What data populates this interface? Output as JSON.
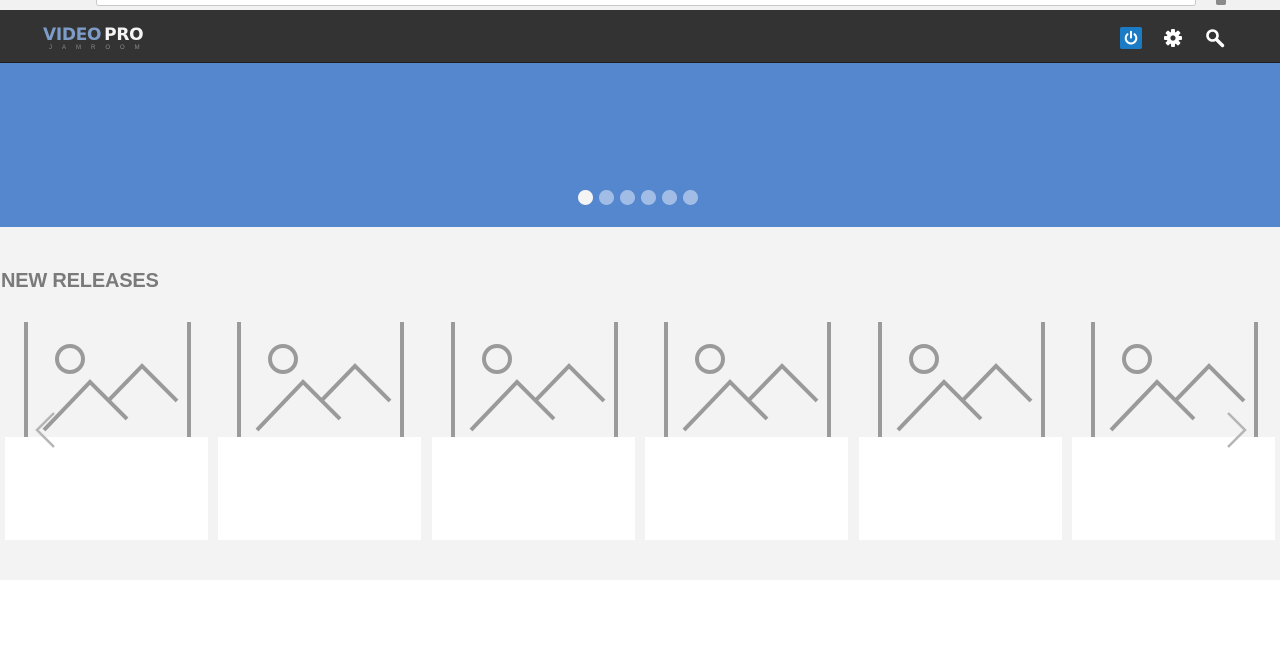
{
  "header": {
    "logo": {
      "part1": "VIDEO",
      "part2": "PRO",
      "sub": "JAMROOM"
    },
    "icons": [
      "power-icon",
      "gear-icon",
      "search-icon"
    ]
  },
  "slider": {
    "background": "#5587cf",
    "dot_count": 6,
    "active_index": 0
  },
  "releases": {
    "title": "NEW RELEASES",
    "cards": [
      {
        "image": "image-placeholder-icon"
      },
      {
        "image": "image-placeholder-icon"
      },
      {
        "image": "image-placeholder-icon"
      },
      {
        "image": "image-placeholder-icon"
      },
      {
        "image": "image-placeholder-icon"
      },
      {
        "image": "image-placeholder-icon"
      }
    ]
  },
  "colors": {
    "nav": "#333333",
    "accent": "#1b7bc4",
    "section_bg": "#f3f3f3",
    "title": "#7a7a7a"
  }
}
